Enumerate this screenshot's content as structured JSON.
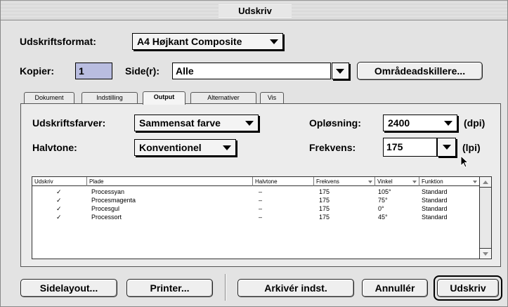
{
  "window": {
    "title": "Udskriv"
  },
  "format": {
    "label": "Udskriftsformat:",
    "value": "A4 Højkant Composite"
  },
  "copies": {
    "label": "Kopier:",
    "value": "1"
  },
  "pages": {
    "label": "Side(r):",
    "value": "Alle",
    "separators_button": "Områdeadskillere..."
  },
  "tabs": [
    {
      "label": "Dokument"
    },
    {
      "label": "Indstilling"
    },
    {
      "label": "Output"
    },
    {
      "label": "Alternativer"
    },
    {
      "label": "Vis"
    }
  ],
  "output": {
    "colors_label": "Udskriftsfarver:",
    "colors_value": "Sammensat farve",
    "halftone_label": "Halvtone:",
    "halftone_value": "Konventionel",
    "resolution_label": "Opløsning:",
    "resolution_value": "2400",
    "resolution_unit": "(dpi)",
    "frequency_label": "Frekvens:",
    "frequency_value": "175",
    "frequency_unit": "(lpi)"
  },
  "table": {
    "headers": [
      "Udskriv",
      "Plade",
      "Halvtone",
      "Frekvens",
      "Vinkel",
      "Funktion"
    ],
    "rows": [
      {
        "print": "✓",
        "plate": "Processyan",
        "halftone": "–",
        "frequency": "175",
        "angle": "105°",
        "function": "Standard"
      },
      {
        "print": "✓",
        "plate": "Procesmagenta",
        "halftone": "–",
        "frequency": "175",
        "angle": "75°",
        "function": "Standard"
      },
      {
        "print": "✓",
        "plate": "Procesgul",
        "halftone": "–",
        "frequency": "175",
        "angle": "0°",
        "function": "Standard"
      },
      {
        "print": "✓",
        "plate": "Processort",
        "halftone": "–",
        "frequency": "175",
        "angle": "45°",
        "function": "Standard"
      }
    ]
  },
  "buttons": {
    "page_layout": "Sidelayout...",
    "printer": "Printer...",
    "archive": "Arkivér indst.",
    "cancel": "Annullér",
    "print": "Udskriv"
  },
  "colors": {
    "accent_field": "#b9bde0"
  }
}
